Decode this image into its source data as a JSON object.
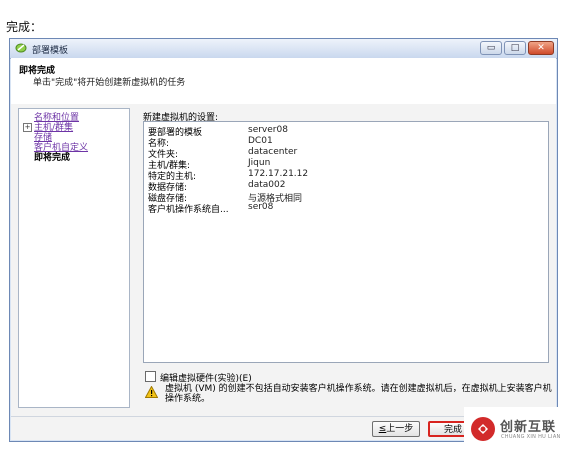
{
  "caption": "完成：",
  "window": {
    "title": "部署模板",
    "buttons": {
      "minimize": "▭",
      "maximize": "□",
      "close": "✕"
    }
  },
  "header": {
    "title": "即将完成",
    "subtitle": "单击\"完成\"将开始创建新虚拟机的任务"
  },
  "sidebar": {
    "items": [
      {
        "label": "名称和位置",
        "expandable": false
      },
      {
        "label": "主机/群集",
        "expandable": true,
        "expander": "+"
      },
      {
        "label": "存储",
        "expandable": false
      },
      {
        "label": "客户机自定义",
        "expandable": false
      },
      {
        "label": "即将完成",
        "expandable": false,
        "current": true
      }
    ]
  },
  "settings": {
    "label": "新建虚拟机的设置:",
    "rows": [
      {
        "key": "要部署的模板",
        "value": "server08"
      },
      {
        "key": "名称:",
        "value": "DC01"
      },
      {
        "key": "文件夹:",
        "value": "datacenter"
      },
      {
        "key": "主机/群集:",
        "value": "Jiqun"
      },
      {
        "key": "特定的主机:",
        "value": "172.17.21.12"
      },
      {
        "key": "数据存储:",
        "value": "data002"
      },
      {
        "key": "磁盘存储:",
        "value": "与源格式相同"
      },
      {
        "key": "客户机操作系统自...",
        "value": "ser08"
      }
    ]
  },
  "edit_hardware": {
    "label": "编辑虚拟硬件(实验)(E)",
    "checked": false
  },
  "warning": {
    "icon": "warning-icon",
    "text": "虚拟机 (VM) 的创建不包括自动安装客户机操作系统。请在创建虚拟机后，在虚拟机上安装客户机操作系统。"
  },
  "footer": {
    "back_key": "≤",
    "back_label": "上一步",
    "finish_label": "完成"
  },
  "watermark": {
    "text": "创新互联",
    "sub": "CHUANG XIN HU LIAN"
  },
  "colors": {
    "highlight_red": "#d8241f",
    "link_purple": "#6d34a6",
    "title_blue": "#c9d8ee"
  }
}
